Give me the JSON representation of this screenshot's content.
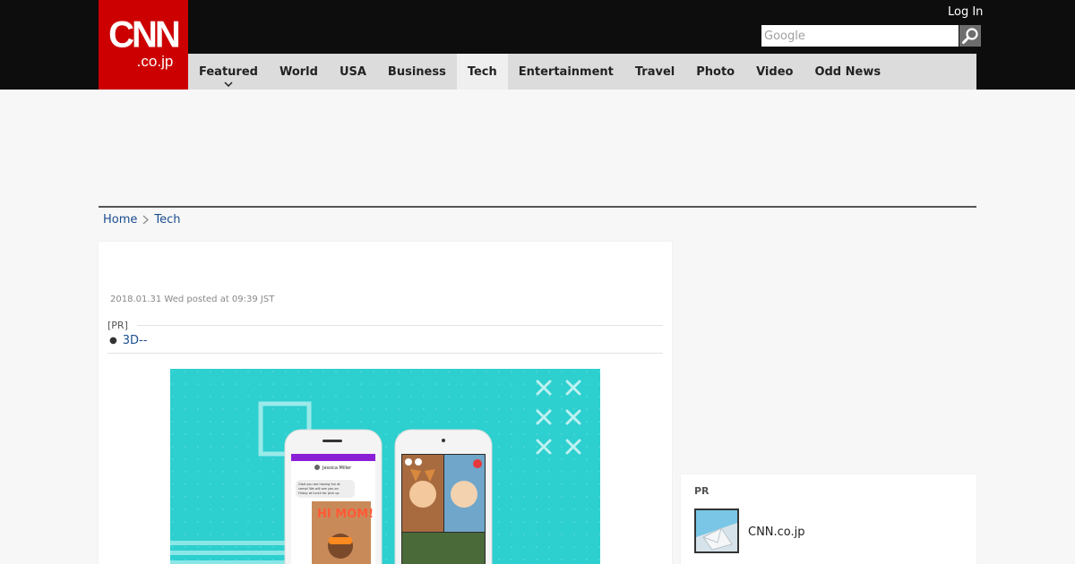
{
  "header": {
    "logo_main": "CNN",
    "logo_sub": ".co.jp",
    "login_label": "Log In",
    "search_placeholder": "Google"
  },
  "nav": {
    "items": [
      {
        "label": "Featured"
      },
      {
        "label": "World"
      },
      {
        "label": "USA"
      },
      {
        "label": "Business"
      },
      {
        "label": "Tech"
      },
      {
        "label": "Entertainment"
      },
      {
        "label": "Travel"
      },
      {
        "label": "Photo"
      },
      {
        "label": "Video"
      },
      {
        "label": "Odd News"
      }
    ],
    "active": "Tech"
  },
  "breadcrumb": {
    "home": "Home",
    "current": "Tech"
  },
  "article": {
    "posted": "2018.01.31 Wed posted at 09:39 JST",
    "pr_label": "[PR]",
    "pr_link": "3D--",
    "hero_image": {
      "phone_left": {
        "contact": "Jessica Miller",
        "message": "Glad you are having fun at camp! We will see you on Friday at lunch for pick up",
        "sticker": "HI MOM!"
      }
    }
  },
  "sidebar": {
    "pr_title": "PR",
    "pr_item_text": "CNN.co.jp"
  },
  "colors": {
    "logo_red": "#cc0000",
    "header_black": "#0d0d0d",
    "nav_gray": "#dcdcdc",
    "link_blue": "#1a4d8f",
    "hero_teal": "#2dcfcf"
  }
}
